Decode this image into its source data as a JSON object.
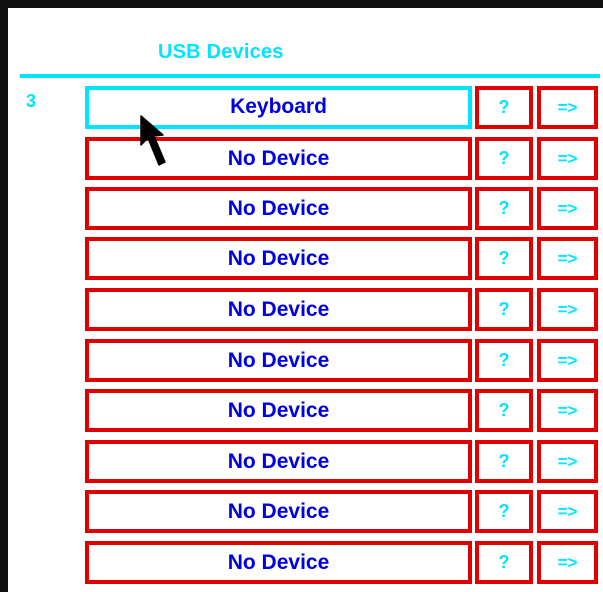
{
  "header": {
    "title": "USB Devices",
    "accent_color": "#00e5ff"
  },
  "device_count": "3",
  "selected_index": 0,
  "rows": [
    {
      "label": "Keyboard",
      "info_label": "?",
      "open_label": "=>"
    },
    {
      "label": "No Device",
      "info_label": "?",
      "open_label": "=>"
    },
    {
      "label": "No Device",
      "info_label": "?",
      "open_label": "=>"
    },
    {
      "label": "No Device",
      "info_label": "?",
      "open_label": "=>"
    },
    {
      "label": "No Device",
      "info_label": "?",
      "open_label": "=>"
    },
    {
      "label": "No Device",
      "info_label": "?",
      "open_label": "=>"
    },
    {
      "label": "No Device",
      "info_label": "?",
      "open_label": "=>"
    },
    {
      "label": "No Device",
      "info_label": "?",
      "open_label": "=>"
    },
    {
      "label": "No Device",
      "info_label": "?",
      "open_label": "=>"
    },
    {
      "label": "No Device",
      "info_label": "?",
      "open_label": "=>"
    }
  ],
  "colors": {
    "border_red": "#e00000",
    "selected_border": "#00e5ff",
    "device_text": "#0000e6",
    "button_text": "#00e5ff",
    "frame": "#111111"
  },
  "icons": {
    "pointer": "mouse-pointer-icon"
  }
}
